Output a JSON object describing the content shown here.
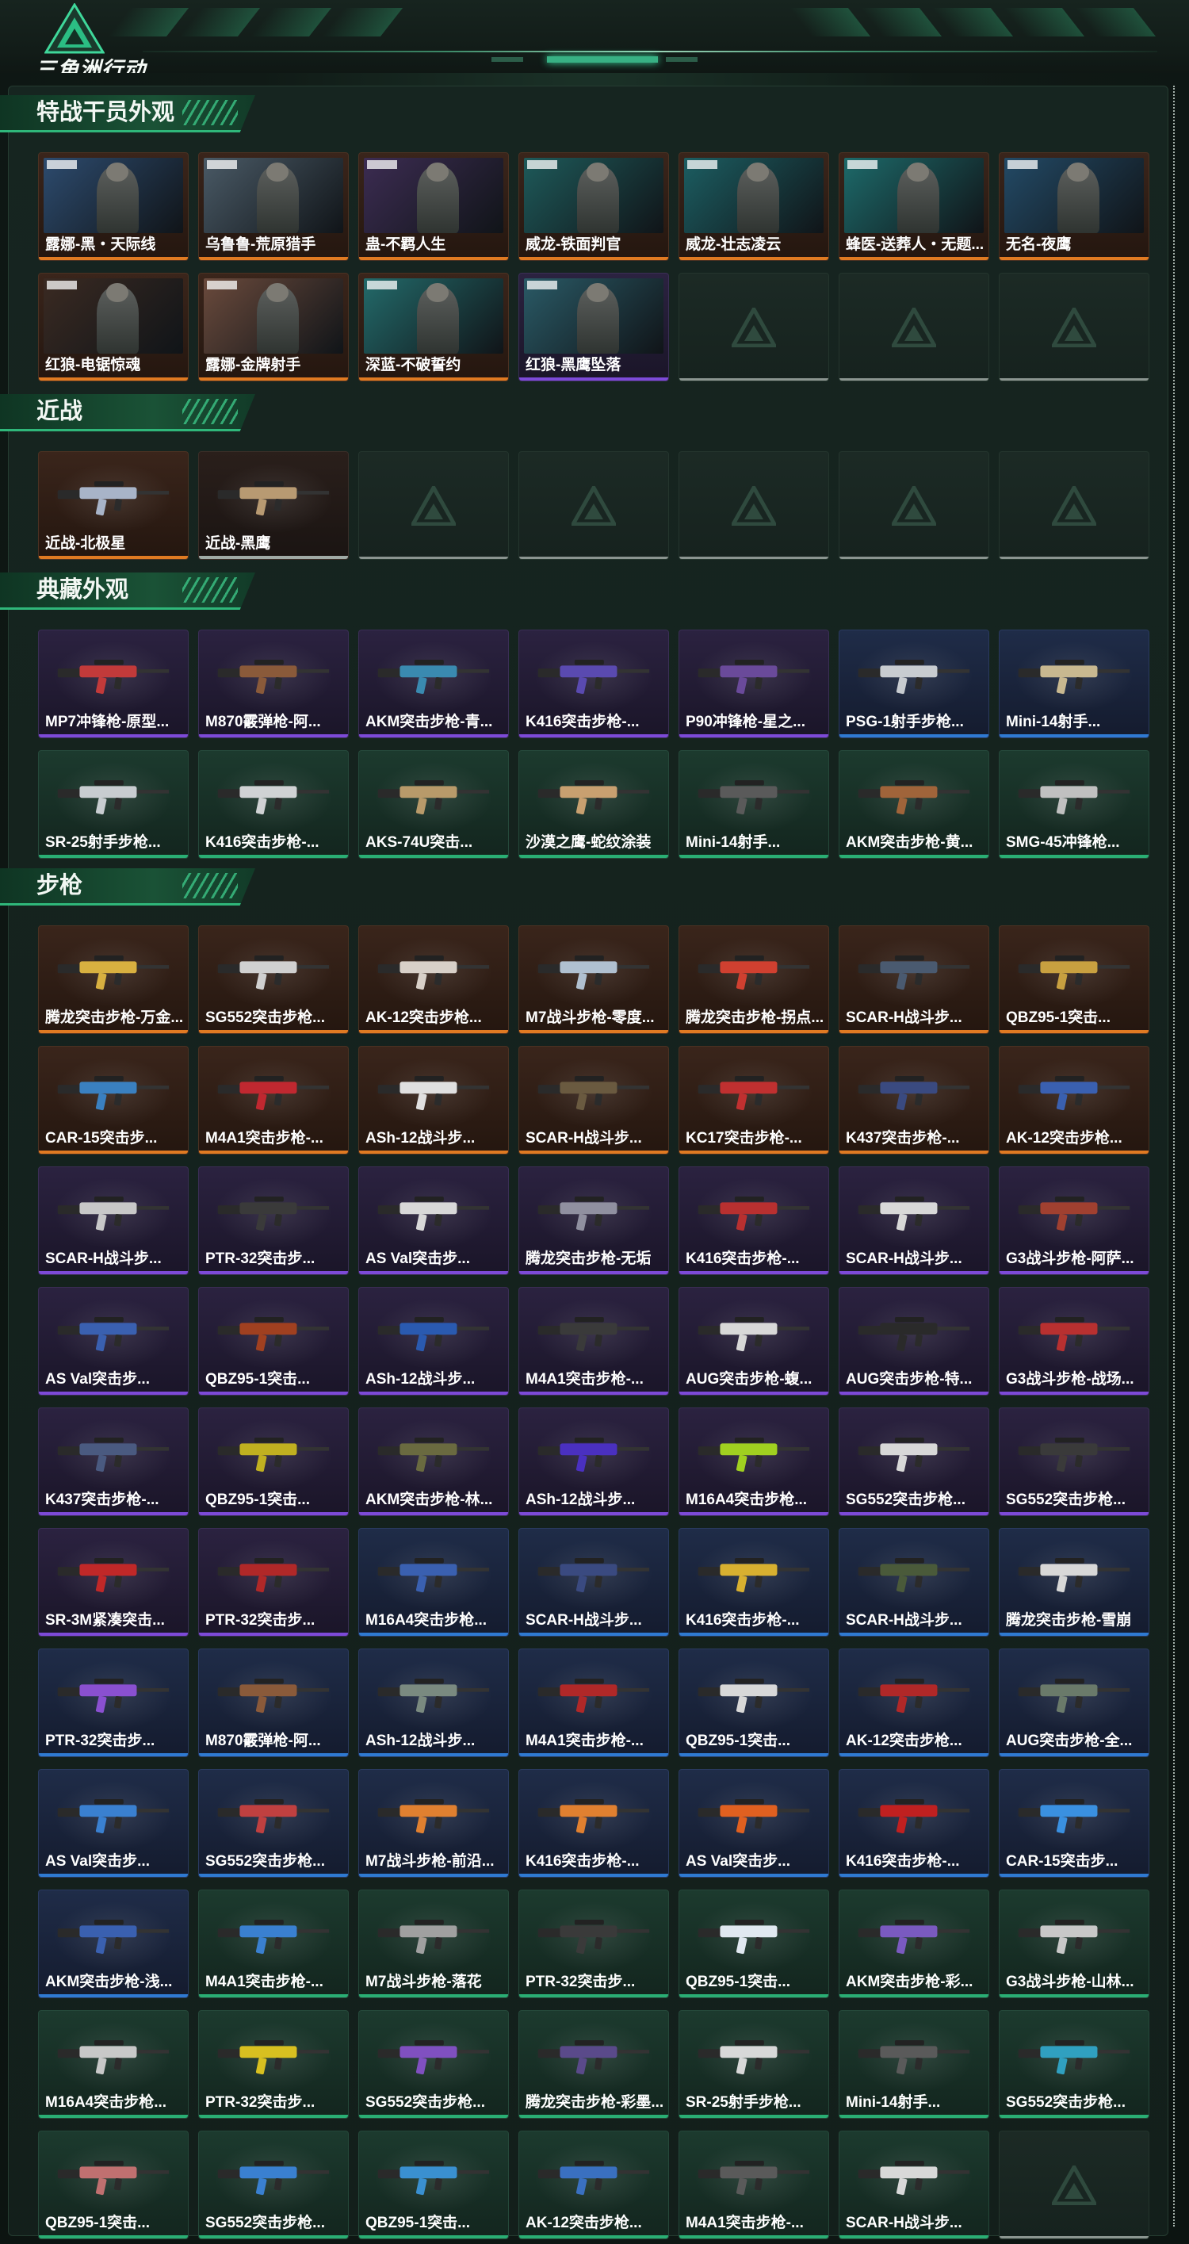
{
  "header": {
    "logo_text": "三角洲行动"
  },
  "colors": {
    "accent": "#2fb77a",
    "orange": "#e07a22",
    "purple": "#7d4ad8",
    "blue": "#2f7ad2",
    "green": "#2aae74",
    "silver": "#a0aaa5"
  },
  "sections": [
    {
      "title": "特战干员外观",
      "kind": "operator",
      "items": [
        {
          "label": "露娜-黑・天际线",
          "rarity": "orange",
          "bg": "#2d4b6e"
        },
        {
          "label": "乌鲁鲁-荒原猎手",
          "rarity": "orange",
          "bg": "#4a5a66"
        },
        {
          "label": "蛊-不羁人生",
          "rarity": "orange",
          "bg": "#3c2c52"
        },
        {
          "label": "威龙-铁面判官",
          "rarity": "orange",
          "bg": "#1e5a5a"
        },
        {
          "label": "威龙-壮志凌云",
          "rarity": "orange",
          "bg": "#1c5e62"
        },
        {
          "label": "蜂医-送葬人・无题...",
          "rarity": "orange",
          "bg": "#1d6a6a"
        },
        {
          "label": "无名-夜鹰",
          "rarity": "orange",
          "bg": "#234a66"
        },
        {
          "label": "红狼-电锯惊魂",
          "rarity": "orange",
          "bg": "#3a2a22"
        },
        {
          "label": "露娜-金牌射手",
          "rarity": "orange",
          "bg": "#6a4a3c"
        },
        {
          "label": "深蓝-不破誓约",
          "rarity": "orange",
          "bg": "#236a6a"
        },
        {
          "label": "红狼-黑鹰坠落",
          "rarity": "purple",
          "bg": "#2a5a66"
        },
        {
          "empty": true
        },
        {
          "empty": true
        },
        {
          "empty": true
        }
      ]
    },
    {
      "title": "近战",
      "kind": "melee",
      "items": [
        {
          "label": "近战-北极星",
          "rarity": "orange",
          "gun": "#a8b4c8"
        },
        {
          "label": "近战-黑鹰",
          "rarity": "silver",
          "gun": "#b89a72"
        },
        {
          "empty": true
        },
        {
          "empty": true
        },
        {
          "empty": true
        },
        {
          "empty": true
        },
        {
          "empty": true
        }
      ]
    },
    {
      "title": "典藏外观",
      "kind": "weapon",
      "items": [
        {
          "label": "MP7冲锋枪-原型...",
          "rarity": "purple",
          "gun": "#c23a3a"
        },
        {
          "label": "M870霰弹枪-阿...",
          "rarity": "purple",
          "gun": "#8a5a3a"
        },
        {
          "label": "AKM突击步枪-青...",
          "rarity": "purple",
          "gun": "#3a8ab0"
        },
        {
          "label": "K416突击步枪-...",
          "rarity": "purple",
          "gun": "#5a4ab0"
        },
        {
          "label": "P90冲锋枪-星之...",
          "rarity": "purple",
          "gun": "#6a4a9a"
        },
        {
          "label": "PSG-1射手步枪...",
          "rarity": "blue",
          "gun": "#c8ccd0"
        },
        {
          "label": "Mini-14射手...",
          "rarity": "blue",
          "gun": "#c8b890"
        },
        {
          "label": "SR-25射手步枪...",
          "rarity": "green",
          "gun": "#c8ccd0"
        },
        {
          "label": "K416突击步枪-...",
          "rarity": "green",
          "gun": "#d0d2d4"
        },
        {
          "label": "AKS-74U突击...",
          "rarity": "green",
          "gun": "#b89a6a"
        },
        {
          "label": "沙漠之鹰-蛇纹涂装",
          "rarity": "green",
          "gun": "#c8a070"
        },
        {
          "label": "Mini-14射手...",
          "rarity": "green",
          "gun": "#5a5a5a"
        },
        {
          "label": "AKM突击步枪-黄...",
          "rarity": "green",
          "gun": "#a0643a"
        },
        {
          "label": "SMG-45冲锋枪...",
          "rarity": "green",
          "gun": "#c0c0c0"
        }
      ]
    },
    {
      "title": "步枪",
      "kind": "weapon",
      "items": [
        {
          "label": "腾龙突击步枪-万金...",
          "rarity": "orange",
          "gun": "#d8b040"
        },
        {
          "label": "SG552突击步枪...",
          "rarity": "orange",
          "gun": "#d0d0d0"
        },
        {
          "label": "AK-12突击步枪...",
          "rarity": "orange",
          "gun": "#d8d0c8"
        },
        {
          "label": "M7战斗步枪-零度...",
          "rarity": "orange",
          "gun": "#b0c0d0"
        },
        {
          "label": "腾龙突击步枪-拐点...",
          "rarity": "orange",
          "gun": "#d04030"
        },
        {
          "label": "SCAR-H战斗步...",
          "rarity": "orange",
          "gun": "#4a5a70"
        },
        {
          "label": "QBZ95-1突击...",
          "rarity": "orange",
          "gun": "#c8a040"
        },
        {
          "label": "CAR-15突击步...",
          "rarity": "orange",
          "gun": "#3a80c0"
        },
        {
          "label": "M4A1突击步枪-...",
          "rarity": "orange",
          "gun": "#c02830"
        },
        {
          "label": "ASh-12战斗步...",
          "rarity": "orange",
          "gun": "#e0e0e0"
        },
        {
          "label": "SCAR-H战斗步...",
          "rarity": "orange",
          "gun": "#6a5a40"
        },
        {
          "label": "KC17突击步枪-...",
          "rarity": "orange",
          "gun": "#c03030"
        },
        {
          "label": "K437突击步枪-...",
          "rarity": "orange",
          "gun": "#3a4a80"
        },
        {
          "label": "AK-12突击步枪...",
          "rarity": "orange",
          "gun": "#3a60b0"
        },
        {
          "label": "SCAR-H战斗步...",
          "rarity": "purple",
          "gun": "#c8c8c8"
        },
        {
          "label": "PTR-32突击步...",
          "rarity": "purple",
          "gun": "#3a3a3a"
        },
        {
          "label": "AS Val突击步...",
          "rarity": "purple",
          "gun": "#d8d8d8"
        },
        {
          "label": "腾龙突击步枪-无垢",
          "rarity": "purple",
          "gun": "#9090a0"
        },
        {
          "label": "K416突击步枪-...",
          "rarity": "purple",
          "gun": "#b83030"
        },
        {
          "label": "SCAR-H战斗步...",
          "rarity": "purple",
          "gun": "#d8d8d8"
        },
        {
          "label": "G3战斗步枪-阿萨...",
          "rarity": "purple",
          "gun": "#a04030"
        },
        {
          "label": "AS Val突击步...",
          "rarity": "purple",
          "gun": "#3a60b0"
        },
        {
          "label": "QBZ95-1突击...",
          "rarity": "purple",
          "gun": "#a04020"
        },
        {
          "label": "ASh-12战斗步...",
          "rarity": "purple",
          "gun": "#2a5ab0"
        },
        {
          "label": "M4A1突击步枪-...",
          "rarity": "purple",
          "gun": "#3a3a3a"
        },
        {
          "label": "AUG突击步枪-蝮...",
          "rarity": "purple",
          "gun": "#d8d8d8"
        },
        {
          "label": "AUG突击步枪-特...",
          "rarity": "purple",
          "gun": "#2a2a2a"
        },
        {
          "label": "G3战斗步枪-战场...",
          "rarity": "purple",
          "gun": "#b83030"
        },
        {
          "label": "K437突击步枪-...",
          "rarity": "purple",
          "gun": "#4a5a80"
        },
        {
          "label": "QBZ95-1突击...",
          "rarity": "purple",
          "gun": "#c0b020"
        },
        {
          "label": "AKM突击步枪-林...",
          "rarity": "purple",
          "gun": "#6a6a40"
        },
        {
          "label": "ASh-12战斗步...",
          "rarity": "purple",
          "gun": "#4a30c0"
        },
        {
          "label": "M16A4突击步枪...",
          "rarity": "purple",
          "gun": "#a0d020"
        },
        {
          "label": "SG552突击步枪...",
          "rarity": "purple",
          "gun": "#d8d8d8"
        },
        {
          "label": "SG552突击步枪...",
          "rarity": "purple",
          "gun": "#3a3a3a"
        },
        {
          "label": "SR-3M紧凑突击...",
          "rarity": "purple",
          "gun": "#c02828"
        },
        {
          "label": "PTR-32突击步...",
          "rarity": "purple",
          "gun": "#b02828"
        },
        {
          "label": "M16A4突击步枪...",
          "rarity": "blue",
          "gun": "#3a60b0"
        },
        {
          "label": "SCAR-H战斗步...",
          "rarity": "blue",
          "gun": "#3a4a80"
        },
        {
          "label": "K416突击步枪-...",
          "rarity": "blue",
          "gun": "#d8b030"
        },
        {
          "label": "SCAR-H战斗步...",
          "rarity": "blue",
          "gun": "#4a5a3a"
        },
        {
          "label": "腾龙突击步枪-雪崩",
          "rarity": "blue",
          "gun": "#d8d8d8"
        },
        {
          "label": "PTR-32突击步...",
          "rarity": "blue",
          "gun": "#8a50d0"
        },
        {
          "label": "M870霰弹枪-阿...",
          "rarity": "blue",
          "gun": "#8a5a3a"
        },
        {
          "label": "ASh-12战斗步...",
          "rarity": "blue",
          "gun": "#7a8a80"
        },
        {
          "label": "M4A1突击步枪-...",
          "rarity": "blue",
          "gun": "#b02828"
        },
        {
          "label": "QBZ95-1突击...",
          "rarity": "blue",
          "gun": "#d8d8d8"
        },
        {
          "label": "AK-12突击步枪...",
          "rarity": "blue",
          "gun": "#b02828"
        },
        {
          "label": "AUG突击步枪-全...",
          "rarity": "blue",
          "gun": "#6a7a6a"
        },
        {
          "label": "AS Val突击步...",
          "rarity": "blue",
          "gun": "#3a80d0"
        },
        {
          "label": "SG552突击步枪...",
          "rarity": "blue",
          "gun": "#c04040"
        },
        {
          "label": "M7战斗步枪-前沿...",
          "rarity": "blue",
          "gun": "#e08030"
        },
        {
          "label": "K416突击步枪-...",
          "rarity": "blue",
          "gun": "#e08030"
        },
        {
          "label": "AS Val突击步...",
          "rarity": "blue",
          "gun": "#e06020"
        },
        {
          "label": "K416突击步枪-...",
          "rarity": "blue",
          "gun": "#c02020"
        },
        {
          "label": "CAR-15突击步...",
          "rarity": "blue",
          "gun": "#3a90e0"
        },
        {
          "label": "AKM突击步枪-浅...",
          "rarity": "blue",
          "gun": "#3a60b0"
        },
        {
          "label": "M4A1突击步枪-...",
          "rarity": "green",
          "gun": "#3a80d0"
        },
        {
          "label": "M7战斗步枪-落花",
          "rarity": "green",
          "gun": "#a0a0a0"
        },
        {
          "label": "PTR-32突击步...",
          "rarity": "green",
          "gun": "#3a3a3a"
        },
        {
          "label": "QBZ95-1突击...",
          "rarity": "green",
          "gun": "#e0e8f0"
        },
        {
          "label": "AKM突击步枪-彩...",
          "rarity": "green",
          "gun": "#7a5ac0"
        },
        {
          "label": "G3战斗步枪-山林...",
          "rarity": "green",
          "gun": "#c8c8c8"
        },
        {
          "label": "M16A4突击步枪...",
          "rarity": "green",
          "gun": "#c8c8c8"
        },
        {
          "label": "PTR-32突击步...",
          "rarity": "green",
          "gun": "#d8c020"
        },
        {
          "label": "SG552突击步枪...",
          "rarity": "green",
          "gun": "#8050c0"
        },
        {
          "label": "腾龙突击步枪-彩墨...",
          "rarity": "green",
          "gun": "#5a4a8a"
        },
        {
          "label": "SR-25射手步枪...",
          "rarity": "green",
          "gun": "#d8d8d8"
        },
        {
          "label": "Mini-14射手...",
          "rarity": "green",
          "gun": "#5a5a5a"
        },
        {
          "label": "SG552突击步枪...",
          "rarity": "green",
          "gun": "#30a0c0"
        },
        {
          "label": "QBZ95-1突击...",
          "rarity": "green",
          "gun": "#c07070"
        },
        {
          "label": "SG552突击步枪...",
          "rarity": "green",
          "gun": "#3a80d0"
        },
        {
          "label": "QBZ95-1突击...",
          "rarity": "green",
          "gun": "#3a90d0"
        },
        {
          "label": "AK-12突击步枪...",
          "rarity": "green",
          "gun": "#3a70c0"
        },
        {
          "label": "M4A1突击步枪-...",
          "rarity": "green",
          "gun": "#5a5a5a"
        },
        {
          "label": "SCAR-H战斗步...",
          "rarity": "green",
          "gun": "#d8d8d8"
        },
        {
          "empty": true
        }
      ]
    }
  ]
}
